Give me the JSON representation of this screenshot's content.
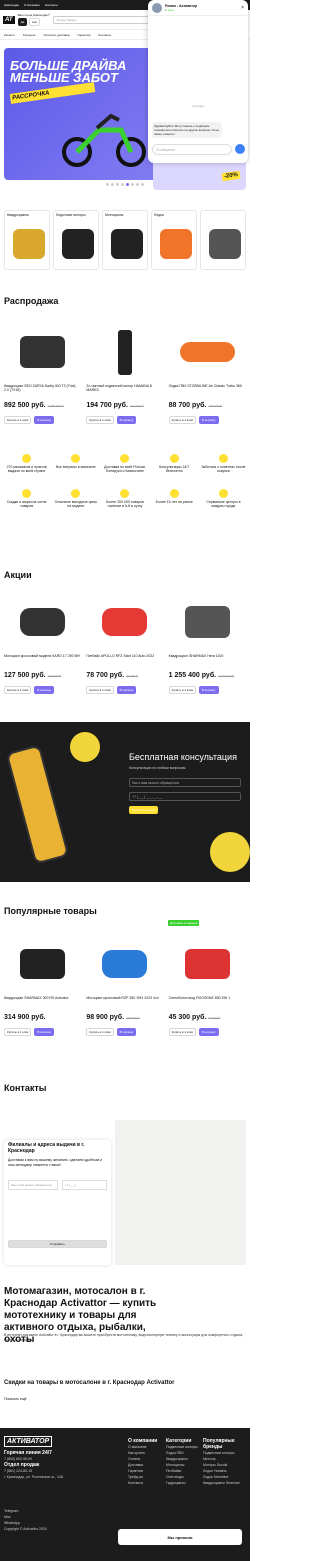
{
  "topbar": {
    "city": "Краснодар",
    "links": [
      "О магазине",
      "Контакты"
    ],
    "right": [
      "Telegram",
      "WhatsApp"
    ]
  },
  "header": {
    "logo": "AT",
    "account_q": "Ваш город Краснодар?",
    "yes": "Да",
    "no": "Нет",
    "search_placeholder": "Я ищу Товары"
  },
  "menu": [
    "Каталог",
    "Тренд-ок",
    "Оплата и доставка",
    "Гарантии",
    "Контакты"
  ],
  "hero": {
    "line1": "БОЛЬШЕ ДРАЙВА",
    "line2": "МЕНЬШЕ ЗАБОТ",
    "tag": "РАССРОЧКА",
    "promo_tag": "-20%"
  },
  "categories": [
    "Квадроциклы",
    "Лодочные моторы",
    "Мотоциклы",
    "Лодки",
    ""
  ],
  "sale": {
    "title": "Распродажа",
    "items": [
      {
        "name": "Квадроцикл SEG ZARYA Sadiq 400 T3 (Trial) 2.0 (TX18)",
        "price": "892 500 руб.",
        "old": "1 000 000 ₽"
      },
      {
        "name": "2х-тактный подвесной мотор HAMANA 8 MARKS",
        "price": "194 700 руб.",
        "old": "237 100 ₽"
      },
      {
        "name": "Лодка ПВХ STORMLINE Air Classic Turbo 360",
        "price": "88 700 руб.",
        "old": "125 000 ₽"
      }
    ],
    "buy": "Купить в 1 клик",
    "cart": "В корзину"
  },
  "advantages": [
    "270 магазинов и пунктов выдачи по всей стране",
    "Все витрины в магазине",
    "Доставка по всей России, Беларуси и Казахстане",
    "Консультации 24/7 бесплатно",
    "Заботься о клиентах после покупки",
    "Скидки и акции на сотни товаров",
    "Сезонные выгодные цены на модели",
    "Более 200 000 товаров наличие в 6-й в сутку",
    "Более 15 лет на рынке",
    "Сервисные центры в каждом городе"
  ],
  "promos": {
    "title": "Акции",
    "items": [
      {
        "name": "Мотоцикл кроссовый модели КАЯО 17 250 MH",
        "price": "127 500 руб.",
        "old": "145 000 ₽"
      },
      {
        "name": "Питбайк APOLLO RFZ Start 110 Auto 2022",
        "price": "78 700 руб.",
        "old": "92 600 ₽"
      },
      {
        "name": "Квадроцикл SHARMAX Hera 1100",
        "price": "1 255 400 руб.",
        "old": "1 494 900 ₽"
      }
    ]
  },
  "consult": {
    "title": "Бесплатная консультация",
    "sub": "Консультации по любым вопросам",
    "name_ph": "Как к вам можно обращаться",
    "phone_ph": "+7 (___) ___-__-__",
    "submit": "Получить звонок"
  },
  "popular": {
    "title": "Популярные товары",
    "badge": "Доставка в подарок",
    "items": [
      {
        "name": "Квадроцикл SHARMAX 300 RS Activator",
        "price": "314 900 руб.",
        "old": ""
      },
      {
        "name": "Мотоцикл кроссовый RZP 250 ЭНЗ 2023 4x4",
        "price": "98 900 руб.",
        "old": "105 000 ₽"
      },
      {
        "name": "Снегоболотоход ROOSDNE 800 EW 1",
        "price": "45 300 руб.",
        "old": "52 000 ₽"
      }
    ]
  },
  "contacts": {
    "title": "Контакты",
    "subtitle": "Филиалы и адреса выдачи в г. Краснодар",
    "text": "Доставим к вам по вашему желанию, сделаем удобным и наш менеджер свяжется с вами!",
    "name_ph": "Как к вам можно обращаться",
    "phone_ph": "+7 (___)",
    "submit": "Отправить"
  },
  "seo": {
    "title": "Мотомагазин, мотосалон в г. Краснодар Activattor — купить мототехнику и товары для активного отдыха, рыбалки, охоты",
    "text": "В интернет-магазине Activattor в г. Краснодар вы можете приобрести мототехнику, водномоторную технику и аксессуары для комфортного отдыха, охоты и рыбалки.",
    "more": "Скидки на товары в мотосалоне в г. Краснодар Activattor",
    "toggle": "Показать ещё"
  },
  "footer": {
    "logo": "АКТИВАТОР",
    "phone1": "Горячая линия 24/7",
    "phone1_num": "7 (800) 600-95-00",
    "phone2": "Отдел продаж",
    "phone2_num": "7 (861) 124-80-15",
    "address": "г. Краснодар, ул. Ростовское ш., 14А",
    "col1_title": "О компании",
    "col1": [
      "О магазине",
      "Как купить",
      "Оплата",
      "Доставка",
      "Гарантия",
      "Трейд-ин",
      "Контакты"
    ],
    "col2_title": "Категории",
    "col2": [
      "Подвесные моторы",
      "Лодки ПВХ",
      "Квадроциклы",
      "Мотоциклы",
      "Питбайки",
      "Снегоходы",
      "Гидроциклы"
    ],
    "col3_title": "Популярные бренды",
    "col3": [
      "Подвесные моторы Mercury",
      "Моторы Suzuki",
      "Лодки Yamaha",
      "Лодки Stormline",
      "Квадроциклы Sharmax"
    ],
    "copyright": "Copyright © Activattor 2024",
    "messengers": [
      "Telegram",
      "Max",
      "WhatsApp"
    ]
  },
  "chat": {
    "name": "Роман - Активатор",
    "status": "В сети",
    "time": "Сегодня",
    "message": "Здравствуйте! Могу помочь с подбором техники или ответить на другие вопросы. Я на связи, пишите!",
    "placeholder": "Сообщение"
  },
  "cookie": {
    "accept": "Мы приняли"
  }
}
